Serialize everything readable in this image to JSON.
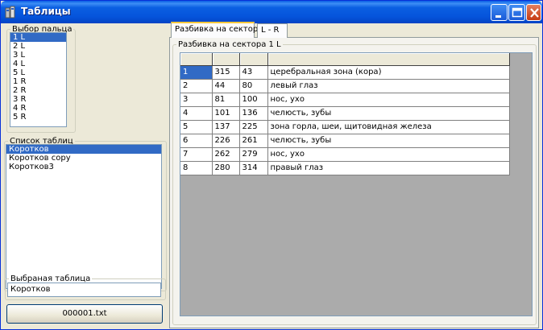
{
  "window": {
    "title": "Таблицы"
  },
  "finger_select": {
    "label": "Выбор пальца",
    "items": [
      "1 L",
      "2 L",
      "3 L",
      "4 L",
      "5 L",
      "1 R",
      "2 R",
      "3 R",
      "4 R",
      "5 R"
    ],
    "selected_index": 0
  },
  "table_list": {
    "label": "Список таблиц",
    "items": [
      "Коротков",
      "Коротков copy",
      "Коротков3"
    ],
    "selected_index": 0
  },
  "chosen_table": {
    "label": "Выбраная таблица",
    "value": "Коротков"
  },
  "file_button": {
    "label": "000001.txt"
  },
  "tabs": [
    {
      "label": "Разбивка на сектора",
      "active": true
    },
    {
      "label": "L - R",
      "active": false
    }
  ],
  "panel": {
    "label": "Разбивка на сектора 1 L",
    "rows": [
      [
        "1",
        "315",
        "43",
        "церебральная зона (кора)"
      ],
      [
        "2",
        "44",
        "80",
        "левый глаз"
      ],
      [
        "3",
        "81",
        "100",
        "нос, ухо"
      ],
      [
        "4",
        "101",
        "136",
        "челюсть, зубы"
      ],
      [
        "5",
        "137",
        "225",
        "зона горла, шеи,  щитовидная железа"
      ],
      [
        "6",
        "226",
        "261",
        "челюсть, зубы"
      ],
      [
        "7",
        "262",
        "279",
        "нос, ухо"
      ],
      [
        "8",
        "280",
        "314",
        "правый глаз"
      ]
    ]
  }
}
